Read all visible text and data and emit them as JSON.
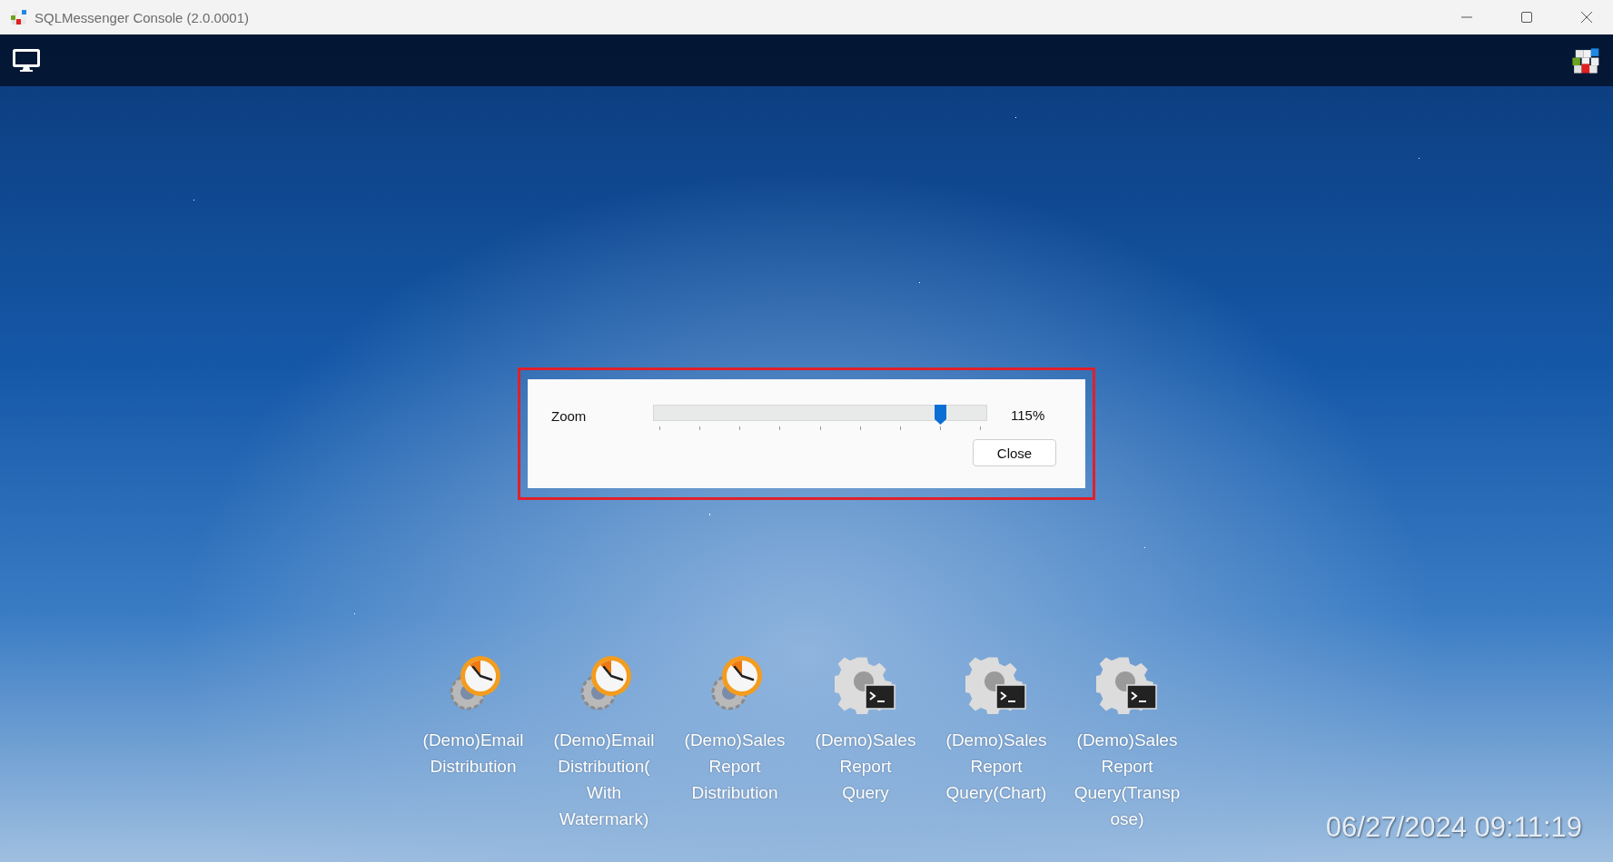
{
  "window": {
    "title": "SQLMessenger Console (2.0.0001)"
  },
  "zoom_dialog": {
    "label": "Zoom",
    "slider": {
      "level": 0.875
    },
    "reading": "115%",
    "buttons": [
      "Close"
    ]
  },
  "desktop_icons": [
    {
      "kind": "scheduler",
      "label": "(Demo)Email\nDistribution"
    },
    {
      "kind": "scheduler",
      "label": "(Demo)Email\nDistribution(\nWith\nWatermark)"
    },
    {
      "kind": "scheduler",
      "label": "(Demo)Sales\nReport\nDistribution"
    },
    {
      "kind": "console",
      "label": "(Demo)Sales\nReport\nQuery"
    },
    {
      "kind": "console",
      "label": "(Demo)Sales\nReport\nQuery(Chart)"
    },
    {
      "kind": "console",
      "label": "(Demo)Sales\nReport\nQuery(Transp\nose)"
    }
  ],
  "clock": "06/27/2024 09:11:19"
}
